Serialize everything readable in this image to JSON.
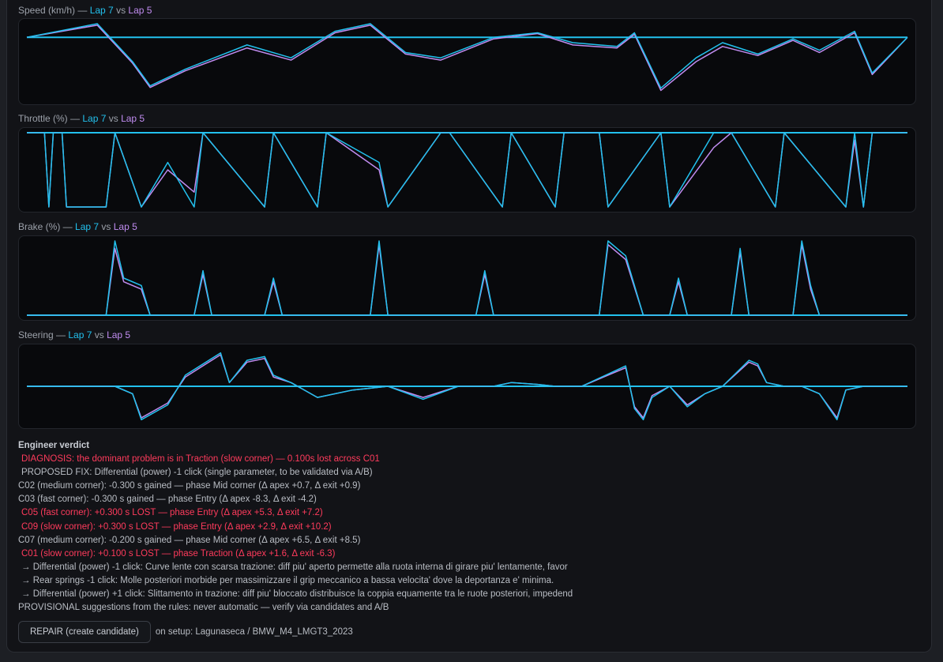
{
  "colors": {
    "lap_a": "#22c1ee",
    "lap_b": "#c08cf0",
    "red": "#ff3b5c"
  },
  "charts": {
    "speed": {
      "title_prefix": "Speed (km/h) — ",
      "lap_a": "Lap 7",
      "vs": " vs ",
      "lap_b": "Lap 5"
    },
    "throttle": {
      "title_prefix": "Throttle (%) — ",
      "lap_a": "Lap 7",
      "vs": " vs ",
      "lap_b": "Lap 5"
    },
    "brake": {
      "title_prefix": "Brake (%) — ",
      "lap_a": "Lap 7",
      "vs": " vs ",
      "lap_b": "Lap 5"
    },
    "steering": {
      "title_prefix": "Steering — ",
      "lap_a": "Lap 7",
      "vs": " vs ",
      "lap_b": "Lap 5"
    }
  },
  "chart_data": [
    {
      "type": "line",
      "title": "Speed (km/h) — Lap 7 vs Lap 5",
      "series": [
        {
          "name": "Lap 7",
          "x": [
            0,
            0.08,
            0.12,
            0.14,
            0.18,
            0.25,
            0.3,
            0.35,
            0.39,
            0.43,
            0.47,
            0.53,
            0.58,
            0.62,
            0.67,
            0.69,
            0.72,
            0.76,
            0.79,
            0.83,
            0.87,
            0.9,
            0.94,
            0.96,
            1.0
          ],
          "y": [
            0.82,
            1.0,
            0.5,
            0.18,
            0.4,
            0.72,
            0.55,
            0.9,
            1.0,
            0.62,
            0.55,
            0.82,
            0.88,
            0.75,
            0.7,
            0.88,
            0.15,
            0.55,
            0.75,
            0.6,
            0.8,
            0.65,
            0.9,
            0.35,
            0.82
          ]
        },
        {
          "name": "Lap 5",
          "x": [
            0,
            0.08,
            0.12,
            0.14,
            0.18,
            0.25,
            0.3,
            0.35,
            0.39,
            0.43,
            0.47,
            0.53,
            0.58,
            0.62,
            0.67,
            0.69,
            0.72,
            0.76,
            0.79,
            0.83,
            0.87,
            0.9,
            0.94,
            0.96,
            1.0
          ],
          "y": [
            0.82,
            0.98,
            0.48,
            0.16,
            0.38,
            0.68,
            0.52,
            0.88,
            0.98,
            0.6,
            0.52,
            0.8,
            0.87,
            0.72,
            0.68,
            0.86,
            0.12,
            0.5,
            0.7,
            0.58,
            0.78,
            0.62,
            0.88,
            0.33,
            0.82
          ]
        }
      ]
    },
    {
      "type": "line",
      "title": "Throttle (%) — Lap 7 vs Lap 5",
      "series": [
        {
          "name": "Lap 7",
          "x": [
            0,
            0.02,
            0.025,
            0.03,
            0.04,
            0.045,
            0.09,
            0.1,
            0.13,
            0.16,
            0.19,
            0.2,
            0.27,
            0.28,
            0.33,
            0.34,
            0.4,
            0.41,
            0.47,
            0.48,
            0.54,
            0.55,
            0.6,
            0.61,
            0.65,
            0.66,
            0.72,
            0.73,
            0.78,
            0.8,
            0.85,
            0.86,
            0.93,
            0.94,
            0.95,
            0.96,
            1.0
          ],
          "y": [
            1,
            1,
            0,
            1,
            1,
            0,
            0,
            1,
            0,
            0.6,
            0,
            1,
            0,
            1,
            0,
            1,
            0.6,
            0,
            1,
            1,
            0,
            1,
            0,
            1,
            1,
            0,
            1,
            0,
            1,
            1,
            0,
            1,
            0,
            1,
            0,
            1,
            1
          ]
        },
        {
          "name": "Lap 5",
          "x": [
            0,
            0.02,
            0.025,
            0.03,
            0.04,
            0.045,
            0.09,
            0.1,
            0.13,
            0.16,
            0.19,
            0.2,
            0.27,
            0.28,
            0.33,
            0.34,
            0.4,
            0.41,
            0.47,
            0.48,
            0.54,
            0.55,
            0.6,
            0.61,
            0.65,
            0.66,
            0.72,
            0.73,
            0.78,
            0.8,
            0.85,
            0.86,
            0.93,
            0.94,
            0.95,
            0.96,
            1.0
          ],
          "y": [
            1,
            1,
            0,
            1,
            1,
            0,
            0,
            1,
            0,
            0.5,
            0.2,
            1,
            0,
            1,
            0,
            1,
            0.5,
            0,
            1,
            1,
            0,
            1,
            0,
            1,
            1,
            0,
            1,
            0,
            0.8,
            1,
            0,
            1,
            0,
            0.9,
            0,
            1,
            1
          ]
        }
      ]
    },
    {
      "type": "line",
      "title": "Brake (%) — Lap 7 vs Lap 5",
      "series": [
        {
          "name": "Lap 7",
          "x": [
            0,
            0.09,
            0.1,
            0.11,
            0.13,
            0.14,
            0.19,
            0.2,
            0.21,
            0.27,
            0.28,
            0.29,
            0.39,
            0.4,
            0.41,
            0.51,
            0.52,
            0.53,
            0.65,
            0.66,
            0.68,
            0.7,
            0.73,
            0.74,
            0.75,
            0.8,
            0.81,
            0.82,
            0.87,
            0.88,
            0.89,
            0.9,
            0.91,
            1.0
          ],
          "y": [
            0,
            0,
            1,
            0.5,
            0.4,
            0,
            0,
            0.6,
            0,
            0,
            0.5,
            0,
            0,
            1,
            0,
            0,
            0.6,
            0,
            0,
            1,
            0.8,
            0,
            0,
            0.5,
            0,
            0,
            0.9,
            0,
            0,
            1,
            0.4,
            0,
            0,
            0
          ]
        },
        {
          "name": "Lap 5",
          "x": [
            0,
            0.09,
            0.1,
            0.11,
            0.13,
            0.14,
            0.19,
            0.2,
            0.21,
            0.27,
            0.28,
            0.29,
            0.39,
            0.4,
            0.41,
            0.51,
            0.52,
            0.53,
            0.65,
            0.66,
            0.68,
            0.7,
            0.73,
            0.74,
            0.75,
            0.8,
            0.81,
            0.82,
            0.87,
            0.88,
            0.89,
            0.9,
            0.91,
            1.0
          ],
          "y": [
            0,
            0,
            0.9,
            0.45,
            0.35,
            0,
            0,
            0.55,
            0,
            0,
            0.45,
            0,
            0,
            0.95,
            0,
            0,
            0.55,
            0,
            0,
            0.95,
            0.75,
            0,
            0,
            0.45,
            0,
            0,
            0.85,
            0,
            0,
            0.95,
            0.35,
            0,
            0,
            0
          ]
        }
      ]
    },
    {
      "type": "line",
      "title": "Steering — Lap 7 vs Lap 5",
      "series": [
        {
          "name": "Lap 7",
          "x": [
            0,
            0.1,
            0.12,
            0.13,
            0.16,
            0.18,
            0.22,
            0.23,
            0.25,
            0.27,
            0.28,
            0.3,
            0.33,
            0.37,
            0.41,
            0.45,
            0.49,
            0.53,
            0.55,
            0.58,
            0.6,
            0.63,
            0.68,
            0.69,
            0.7,
            0.71,
            0.73,
            0.75,
            0.77,
            0.79,
            0.82,
            0.83,
            0.84,
            0.86,
            0.88,
            0.9,
            0.92,
            0.93,
            0.95,
            1.0
          ],
          "y": [
            0,
            0,
            -0.2,
            -0.9,
            -0.5,
            0.3,
            0.9,
            0.1,
            0.7,
            0.8,
            0.3,
            0.1,
            -0.3,
            -0.1,
            0,
            -0.35,
            0,
            0,
            0.1,
            0.05,
            0,
            0,
            0.55,
            -0.6,
            -0.9,
            -0.3,
            0,
            -0.55,
            -0.2,
            0,
            0.7,
            0.6,
            0.1,
            0,
            0,
            -0.2,
            -0.9,
            -0.1,
            0,
            0
          ]
        },
        {
          "name": "Lap 5",
          "x": [
            0,
            0.1,
            0.12,
            0.13,
            0.16,
            0.18,
            0.22,
            0.23,
            0.25,
            0.27,
            0.28,
            0.3,
            0.33,
            0.37,
            0.41,
            0.45,
            0.49,
            0.53,
            0.55,
            0.58,
            0.6,
            0.63,
            0.68,
            0.69,
            0.7,
            0.71,
            0.73,
            0.75,
            0.77,
            0.79,
            0.82,
            0.83,
            0.84,
            0.86,
            0.88,
            0.9,
            0.92,
            0.93,
            0.95,
            1.0
          ],
          "y": [
            0,
            0,
            -0.2,
            -0.85,
            -0.45,
            0.25,
            0.85,
            0.1,
            0.65,
            0.75,
            0.25,
            0.1,
            -0.3,
            -0.1,
            0,
            -0.3,
            0,
            0,
            0.1,
            0.05,
            0,
            0,
            0.5,
            -0.55,
            -0.85,
            -0.25,
            0,
            -0.5,
            -0.2,
            0,
            0.65,
            0.55,
            0.1,
            0,
            0,
            -0.2,
            -0.85,
            -0.1,
            0,
            0
          ]
        }
      ]
    }
  ],
  "verdict": {
    "heading": "Engineer verdict",
    "diagnosis": "DIAGNOSIS: the dominant problem is in Traction (slow corner) — 0.100s lost across C01",
    "fix": "PROPOSED FIX: Differential (power) -1 click (single parameter, to be validated via A/B)",
    "corners": [
      {
        "text": "C02 (medium corner): -0.300 s gained — phase Mid corner (Δ apex +0.7, Δ exit +0.9)",
        "lost": false
      },
      {
        "text": "C03 (fast corner): -0.300 s gained — phase Entry (Δ apex -8.3, Δ exit -4.2)",
        "lost": false
      },
      {
        "text": "C05 (fast corner): +0.300 s LOST — phase Entry (Δ apex +5.3, Δ exit +7.2)",
        "lost": true
      },
      {
        "text": "C09 (slow corner): +0.300 s LOST — phase Entry (Δ apex +2.9, Δ exit +10.2)",
        "lost": true
      },
      {
        "text": "C07 (medium corner): -0.200 s gained — phase Mid corner (Δ apex +6.5, Δ exit +8.5)",
        "lost": false
      },
      {
        "text": "C01 (slow corner): +0.100 s LOST — phase Traction (Δ apex +1.6, Δ exit -6.3)",
        "lost": true
      }
    ],
    "suggestions": [
      "→ Differential (power) -1 click: Curve lente con scarsa trazione: diff piu' aperto permette alla ruota interna di girare piu' lentamente, favor",
      "→ Rear springs -1 click: Molle posteriori morbide per massimizzare il grip meccanico a bassa velocita' dove la deportanza e' minima.",
      "→ Differential (power) +1 click: Slittamento in trazione: diff piu' bloccato distribuisce la coppia equamente tra le ruote posteriori, impedend"
    ],
    "provisional": "PROVISIONAL suggestions from the rules: never automatic — verify via candidates and A/B"
  },
  "repair": {
    "button_label": "REPAIR (create candidate)",
    "setup_text": "on setup: Lagunaseca / BMW_M4_LMGT3_2023"
  }
}
